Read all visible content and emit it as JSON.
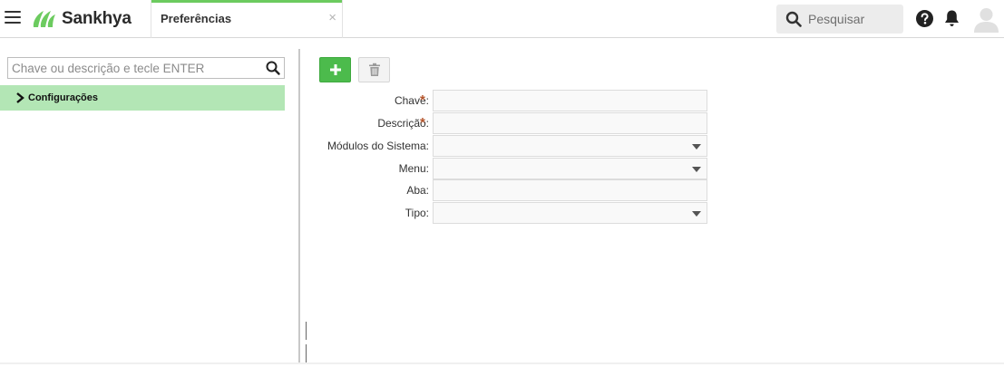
{
  "header": {
    "brand": "Sankhya",
    "tab_label": "Preferências",
    "tab_close": "×",
    "search_placeholder": "Pesquisar"
  },
  "left_panel": {
    "filter_placeholder": "Chave ou descrição e tecle ENTER",
    "tree": [
      {
        "label": "Configurações",
        "expanded": false,
        "selected": true
      }
    ]
  },
  "form": {
    "fields": [
      {
        "label": "Chave:",
        "required": true,
        "type": "text",
        "value": ""
      },
      {
        "label": "Descrição:",
        "required": true,
        "type": "text",
        "value": ""
      },
      {
        "label": "Módulos do Sistema:",
        "required": false,
        "type": "select",
        "value": ""
      },
      {
        "label": "Menu:",
        "required": false,
        "type": "select",
        "value": ""
      },
      {
        "label": "Aba:",
        "required": false,
        "type": "text",
        "value": ""
      },
      {
        "label": "Tipo:",
        "required": false,
        "type": "select",
        "value": ""
      }
    ],
    "required_mark": "*"
  },
  "colors": {
    "brand_green": "#6ccb5f",
    "add_button": "#4cbb4c",
    "tree_selected": "#b3e6b5",
    "required_mark": "#b5562d"
  },
  "icons": {
    "menu": "hamburger-icon",
    "logo": "sankhya-logo-icon",
    "search": "search-icon",
    "help": "help-icon",
    "notifications": "bell-icon",
    "avatar": "user-avatar-icon",
    "tree_expand": "chevron-right-icon",
    "add": "plus-icon",
    "delete": "trash-icon",
    "dropdown": "caret-down-icon"
  }
}
